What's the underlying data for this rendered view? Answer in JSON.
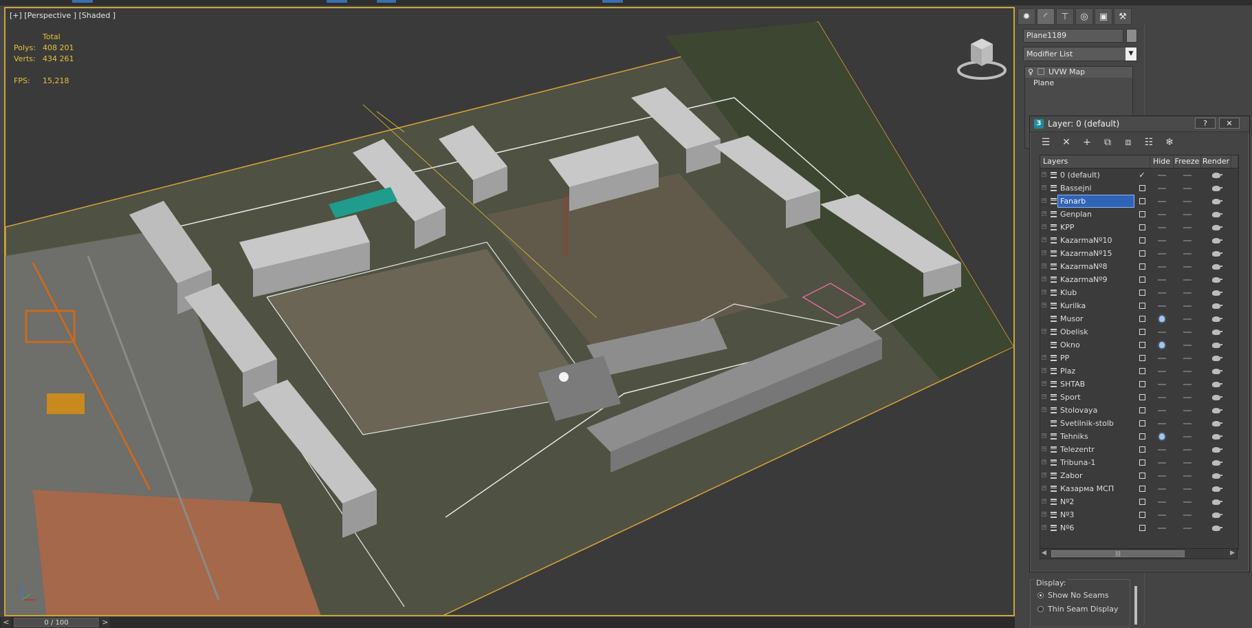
{
  "viewport": {
    "label": "[+] [Perspective ] [Shaded ]",
    "stats": {
      "total_header": "Total",
      "polys_label": "Polys:",
      "polys_value": "408 201",
      "verts_label": "Verts:",
      "verts_value": "434 261",
      "fps_label": "FPS:",
      "fps_value": "15,218"
    },
    "stats_color": "#e3c23a",
    "frame_color": "#c9a63a"
  },
  "timeline": {
    "prev": "<",
    "next": ">",
    "frame_text": "0 / 100"
  },
  "command_panel": {
    "tabs": [
      "create-icon",
      "modify-icon",
      "hierarchy-icon",
      "motion-icon",
      "display-icon",
      "utilities-icon"
    ],
    "object_name": "Plane1189",
    "modifier_list": "Modifier List",
    "stack": [
      "UVW Map",
      "Plane"
    ],
    "display_group": {
      "title": "Display:",
      "options": [
        "Show No Seams",
        "Thin Seam Display"
      ]
    }
  },
  "layer_dialog": {
    "title": "Layer: 0 (default)",
    "help_btn": "?",
    "close_btn": "✕",
    "toolbar": [
      "new-layer-icon",
      "delete-layer-icon",
      "add-to-layer-icon",
      "select-in-layer-icon",
      "highlight-layer-icon",
      "hide-all-icon",
      "freeze-all-icon"
    ],
    "columns": {
      "name": "Layers",
      "hide": "Hide",
      "freeze": "Freeze",
      "render": "Render"
    },
    "selected_color": "#2f64b8",
    "layers": [
      {
        "name": "0 (default)",
        "current": true,
        "expand": true,
        "hide_bulb": false
      },
      {
        "name": "Bassejni",
        "current": false,
        "expand": true,
        "hide_bulb": false
      },
      {
        "name": "Fanarb",
        "current": false,
        "expand": true,
        "hide_bulb": false,
        "selected": true
      },
      {
        "name": "Genplan",
        "current": false,
        "expand": true,
        "hide_bulb": false
      },
      {
        "name": "KPP",
        "current": false,
        "expand": true,
        "hide_bulb": false
      },
      {
        "name": "KazarmaNº10",
        "current": false,
        "expand": true,
        "hide_bulb": false
      },
      {
        "name": "KazarmaNº15",
        "current": false,
        "expand": true,
        "hide_bulb": false
      },
      {
        "name": "KazarmaNº8",
        "current": false,
        "expand": true,
        "hide_bulb": false
      },
      {
        "name": "KazarmaNº9",
        "current": false,
        "expand": true,
        "hide_bulb": false
      },
      {
        "name": "Klub",
        "current": false,
        "expand": true,
        "hide_bulb": false
      },
      {
        "name": "Kurilka",
        "current": false,
        "expand": true,
        "hide_bulb": false
      },
      {
        "name": "Musor",
        "current": false,
        "expand": false,
        "hide_bulb": true
      },
      {
        "name": "Obelisk",
        "current": false,
        "expand": true,
        "hide_bulb": false
      },
      {
        "name": "Okno",
        "current": false,
        "expand": false,
        "hide_bulb": true
      },
      {
        "name": "PP",
        "current": false,
        "expand": true,
        "hide_bulb": false
      },
      {
        "name": "Plaz",
        "current": false,
        "expand": true,
        "hide_bulb": false
      },
      {
        "name": "SHTAB",
        "current": false,
        "expand": true,
        "hide_bulb": false
      },
      {
        "name": "Sport",
        "current": false,
        "expand": true,
        "hide_bulb": false
      },
      {
        "name": "Stolovaya",
        "current": false,
        "expand": true,
        "hide_bulb": false
      },
      {
        "name": "Svetilnik-stolb",
        "current": false,
        "expand": false,
        "hide_bulb": false
      },
      {
        "name": "Tehniks",
        "current": false,
        "expand": true,
        "hide_bulb": true
      },
      {
        "name": "Telezentr",
        "current": false,
        "expand": true,
        "hide_bulb": false
      },
      {
        "name": "Tribuna-1",
        "current": false,
        "expand": true,
        "hide_bulb": false
      },
      {
        "name": "Zabor",
        "current": false,
        "expand": true,
        "hide_bulb": false
      },
      {
        "name": "Казарма МСП",
        "current": false,
        "expand": true,
        "hide_bulb": false
      },
      {
        "name": "Nº2",
        "current": false,
        "expand": true,
        "hide_bulb": false
      },
      {
        "name": "Nº3",
        "current": false,
        "expand": true,
        "hide_bulb": false
      },
      {
        "name": "Nº6",
        "current": false,
        "expand": true,
        "hide_bulb": false
      }
    ]
  }
}
